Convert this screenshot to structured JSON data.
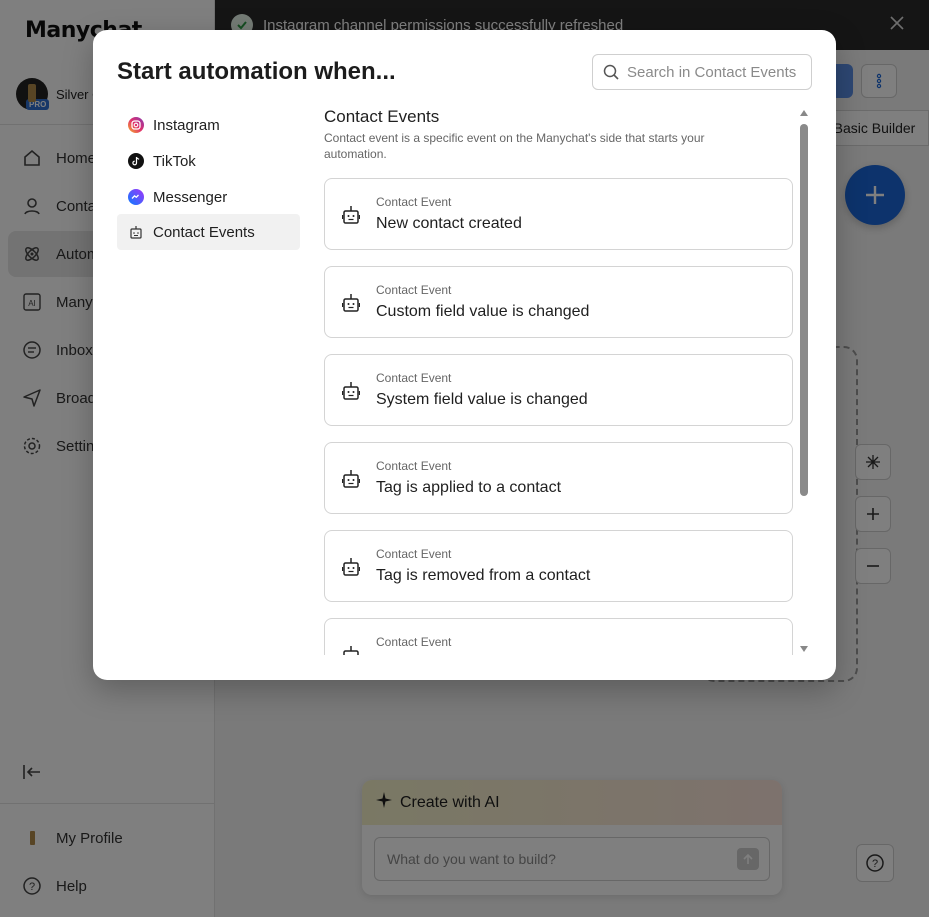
{
  "app": {
    "logo": "Manychat"
  },
  "account": {
    "name": "Silver C",
    "badge": "PRO"
  },
  "sidebar": {
    "items": [
      {
        "label": "Home",
        "icon": "home-icon"
      },
      {
        "label": "Contacts",
        "icon": "user-icon"
      },
      {
        "label": "Automation",
        "icon": "atom-icon"
      },
      {
        "label": "Manychat AI",
        "icon": "ai-icon"
      },
      {
        "label": "Inbox",
        "icon": "chat-icon"
      },
      {
        "label": "Broadcasting",
        "icon": "send-icon"
      },
      {
        "label": "Settings",
        "icon": "gear-icon"
      }
    ],
    "my_profile": "My Profile",
    "help": "Help"
  },
  "notification": {
    "text": "Instagram channel permissions successfully refreshed"
  },
  "canvas": {
    "basic_builder": "Basic Builder"
  },
  "ai_panel": {
    "title": "Create with AI",
    "placeholder": "What do you want to build?"
  },
  "modal": {
    "title": "Start automation when...",
    "search_placeholder": "Search in Contact Events",
    "channels": [
      {
        "label": "Instagram",
        "icon": "instagram-icon"
      },
      {
        "label": "TikTok",
        "icon": "tiktok-icon"
      },
      {
        "label": "Messenger",
        "icon": "messenger-icon"
      },
      {
        "label": "Contact Events",
        "icon": "bot-icon"
      }
    ],
    "section_title": "Contact Events",
    "section_desc": "Contact event is a specific event on the Manychat's side that starts your automation.",
    "events": [
      {
        "kicker": "Contact Event",
        "name": "New contact created"
      },
      {
        "kicker": "Contact Event",
        "name": "Custom field value is changed"
      },
      {
        "kicker": "Contact Event",
        "name": "System field value is changed"
      },
      {
        "kicker": "Contact Event",
        "name": "Tag is applied to a contact"
      },
      {
        "kicker": "Contact Event",
        "name": "Tag is removed from a contact"
      },
      {
        "kicker": "Contact Event",
        "name": ""
      }
    ]
  }
}
